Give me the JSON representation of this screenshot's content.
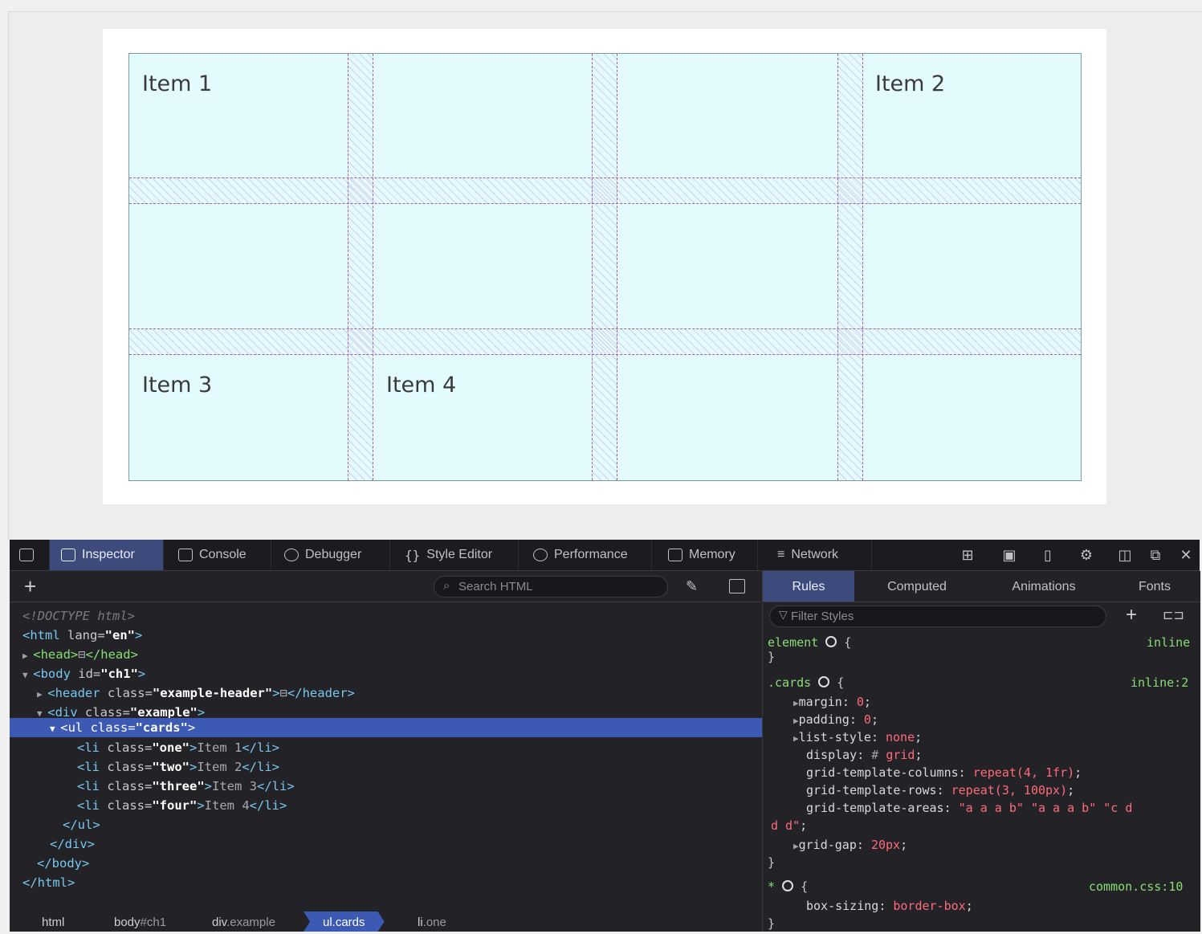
{
  "page": {
    "items": [
      "Item 1",
      "Item 2",
      "Item 3",
      "Item 4"
    ]
  },
  "toolbar": {
    "tabs": [
      {
        "label": "Inspector"
      },
      {
        "label": "Console"
      },
      {
        "label": "Debugger"
      },
      {
        "label": "Style Editor"
      },
      {
        "label": "Performance"
      },
      {
        "label": "Memory"
      },
      {
        "label": "Network"
      }
    ]
  },
  "inspector": {
    "search_placeholder": "Search HTML",
    "tree": [
      {
        "text": "<!DOCTYPE html>"
      },
      {
        "tag_open": "<html",
        "attr": " lang=",
        "val": "\"en\"",
        "tag_close": ">"
      },
      {
        "tag": "<head>",
        "tag_end": "</head>"
      },
      {
        "tag_open": "<body",
        "attr": " id=",
        "val": "\"ch1\"",
        "tag_close": ">"
      },
      {
        "tag_open": "<header",
        "attr": " class=",
        "val": "\"example-header\"",
        "tag_close": ">",
        "tag_end": "</header>"
      },
      {
        "tag_open": "<div",
        "attr": " class=",
        "val": "\"example\"",
        "tag_close": ">"
      },
      {
        "tag_open": "<ul",
        "attr": " class=",
        "val": "\"cards\"",
        "tag_close": ">"
      },
      {
        "tag_open": "<li",
        "attr": " class=",
        "val": "\"one\"",
        "tag_close": ">",
        "text": "Item 1",
        "tag_end": "</li>"
      },
      {
        "tag_open": "<li",
        "attr": " class=",
        "val": "\"two\"",
        "tag_close": ">",
        "text": "Item 2",
        "tag_end": "</li>"
      },
      {
        "tag_open": "<li",
        "attr": " class=",
        "val": "\"three\"",
        "tag_close": ">",
        "text": "Item 3",
        "tag_end": "</li>"
      },
      {
        "tag_open": "<li",
        "attr": " class=",
        "val": "\"four\"",
        "tag_close": ">",
        "text": "Item 4",
        "tag_end": "</li>"
      },
      {
        "tag": "</ul>"
      },
      {
        "tag": "</div>"
      },
      {
        "tag": "</body>"
      },
      {
        "tag": "</html>"
      }
    ],
    "breadcrumbs": [
      {
        "label": "html",
        "sub": ""
      },
      {
        "label": "body",
        "sub": "#ch1"
      },
      {
        "label": "div",
        "sub": ".example"
      },
      {
        "label": "ul.cards",
        "sub": ""
      },
      {
        "label": "li",
        "sub": ".one"
      }
    ]
  },
  "sidebar": {
    "tabs": [
      "Rules",
      "Computed",
      "Animations",
      "Fonts"
    ],
    "filter_placeholder": "Filter Styles",
    "rules": {
      "element_selector": "element",
      "element_source": "inline",
      "cards_selector": ".cards",
      "cards_source": "inline:2",
      "declarations": [
        {
          "prop": "margin",
          "val": "0"
        },
        {
          "prop": "padding",
          "val": "0"
        },
        {
          "prop": "list-style",
          "val": "none"
        },
        {
          "prop": "display",
          "val": "grid"
        },
        {
          "prop": "grid-template-columns",
          "val": "repeat(4, 1fr)"
        },
        {
          "prop": "grid-template-rows",
          "val": "repeat(3, 100px)"
        },
        {
          "prop": "grid-template-areas",
          "val": "\"a a a b\" \"a a a b\" \"c d",
          "cont": "d d\""
        },
        {
          "prop": "grid-gap",
          "val": "20px"
        }
      ],
      "universal_selector": "*",
      "universal_source": "common.css:10",
      "universal_decl": {
        "prop": "box-sizing",
        "val": "border-box"
      }
    }
  },
  "colors": {
    "accent": "#3d4a7c",
    "selection": "#3c5ab4",
    "grid_bg": "#e4fbfd",
    "gap_line": "#a060b0"
  }
}
